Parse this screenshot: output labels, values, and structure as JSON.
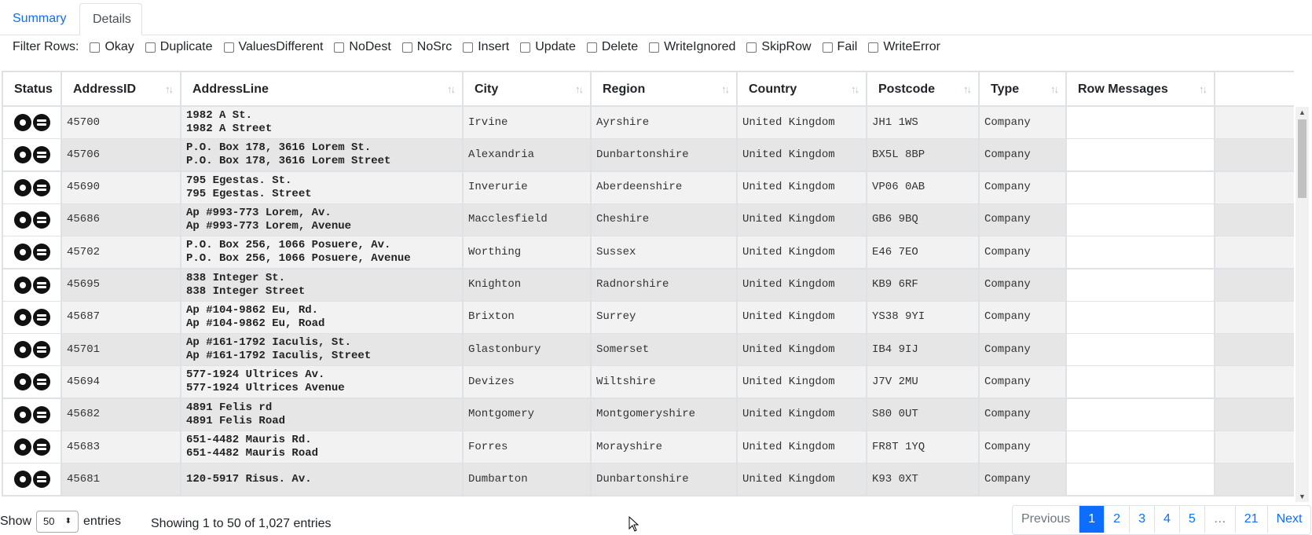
{
  "tabs": {
    "summary": "Summary",
    "details": "Details"
  },
  "filter": {
    "label": "Filter Rows:",
    "options": [
      "Okay",
      "Duplicate",
      "ValuesDifferent",
      "NoDest",
      "NoSrc",
      "Insert",
      "Update",
      "Delete",
      "WriteIgnored",
      "SkipRow",
      "Fail",
      "WriteError"
    ]
  },
  "table": {
    "columns": [
      "Status",
      "AddressID",
      "AddressLine",
      "City",
      "Region",
      "Country",
      "Postcode",
      "Type",
      "Row Messages"
    ],
    "rows": [
      {
        "id": "45700",
        "addr1": "1982 A St.",
        "addr2": "1982 A Street",
        "city": "Irvine",
        "region": "Ayrshire",
        "country": "United Kingdom",
        "postcode": "JH1 1WS",
        "type": "Company",
        "msg": ""
      },
      {
        "id": "45706",
        "addr1": "P.O. Box 178, 3616 Lorem St.",
        "addr2": "P.O. Box 178, 3616 Lorem Street",
        "city": "Alexandria",
        "region": "Dunbartonshire",
        "country": "United Kingdom",
        "postcode": "BX5L 8BP",
        "type": "Company",
        "msg": ""
      },
      {
        "id": "45690",
        "addr1": "795 Egestas. St.",
        "addr2": "795 Egestas. Street",
        "city": "Inverurie",
        "region": "Aberdeenshire",
        "country": "United Kingdom",
        "postcode": "VP06 0AB",
        "type": "Company",
        "msg": ""
      },
      {
        "id": "45686",
        "addr1": "Ap #993-773 Lorem, Av.",
        "addr2": "Ap #993-773 Lorem, Avenue",
        "city": "Macclesfield",
        "region": "Cheshire",
        "country": "United Kingdom",
        "postcode": "GB6 9BQ",
        "type": "Company",
        "msg": ""
      },
      {
        "id": "45702",
        "addr1": "P.O. Box 256, 1066 Posuere, Av.",
        "addr2": "P.O. Box 256, 1066 Posuere, Avenue",
        "city": "Worthing",
        "region": "Sussex",
        "country": "United Kingdom",
        "postcode": "E46 7EO",
        "type": "Company",
        "msg": ""
      },
      {
        "id": "45695",
        "addr1": "838 Integer St.",
        "addr2": "838 Integer Street",
        "city": "Knighton",
        "region": "Radnorshire",
        "country": "United Kingdom",
        "postcode": "KB9 6RF",
        "type": "Company",
        "msg": ""
      },
      {
        "id": "45687",
        "addr1": "Ap #104-9862 Eu, Rd.",
        "addr2": "Ap #104-9862 Eu, Road",
        "city": "Brixton",
        "region": "Surrey",
        "country": "United Kingdom",
        "postcode": "YS38 9YI",
        "type": "Company",
        "msg": ""
      },
      {
        "id": "45701",
        "addr1": "Ap #161-1792 Iaculis, St.",
        "addr2": "Ap #161-1792 Iaculis, Street",
        "city": "Glastonbury",
        "region": "Somerset",
        "country": "United Kingdom",
        "postcode": "IB4 9IJ",
        "type": "Company",
        "msg": ""
      },
      {
        "id": "45694",
        "addr1": "577-1924 Ultrices Av.",
        "addr2": "577-1924 Ultrices Avenue",
        "city": "Devizes",
        "region": "Wiltshire",
        "country": "United Kingdom",
        "postcode": "J7V 2MU",
        "type": "Company",
        "msg": ""
      },
      {
        "id": "45682",
        "addr1": "4891 Felis rd",
        "addr2": "4891 Felis Road",
        "city": "Montgomery",
        "region": "Montgomeryshire",
        "country": "United Kingdom",
        "postcode": "S80 0UT",
        "type": "Company",
        "msg": ""
      },
      {
        "id": "45683",
        "addr1": "651-4482 Mauris Rd.",
        "addr2": "651-4482 Mauris Road",
        "city": "Forres",
        "region": "Morayshire",
        "country": "United Kingdom",
        "postcode": "FR8T 1YQ",
        "type": "Company",
        "msg": ""
      },
      {
        "id": "45681",
        "addr1": "120-5917 Risus. Av.",
        "addr2": "",
        "city": "Dumbarton",
        "region": "Dunbartonshire",
        "country": "United Kingdom",
        "postcode": "K93 0XT",
        "type": "Company",
        "msg": ""
      }
    ]
  },
  "footer": {
    "show": "Show",
    "page_length": "50",
    "entries": "entries",
    "info": "Showing 1 to 50 of 1,027 entries"
  },
  "pager": [
    "Previous",
    "1",
    "2",
    "3",
    "4",
    "5",
    "…",
    "21",
    "Next"
  ],
  "icons": {
    "sort": "sort-arrows-icon",
    "status_a": "dot-circle-icon",
    "status_b": "equals-circle-icon"
  }
}
